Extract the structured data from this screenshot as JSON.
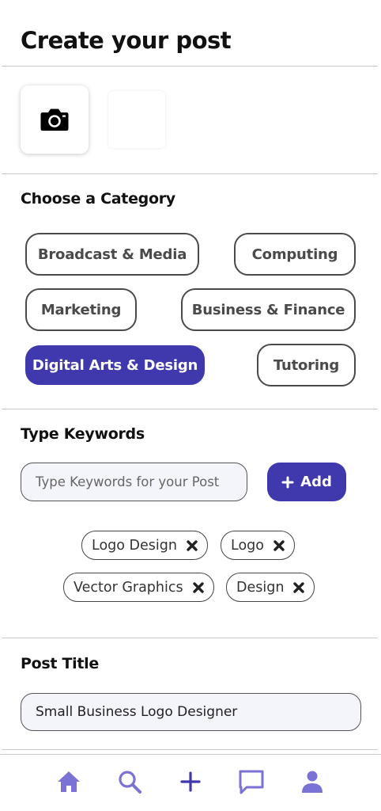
{
  "page": {
    "title": "Create your post"
  },
  "photos": {
    "camera_icon": "camera-icon"
  },
  "category": {
    "label": "Choose a Category",
    "options": [
      {
        "label": "Broadcast & Media",
        "selected": false
      },
      {
        "label": "Computing",
        "selected": false
      },
      {
        "label": "Marketing",
        "selected": false
      },
      {
        "label": "Business & Finance",
        "selected": false
      },
      {
        "label": "Digital Arts & Design",
        "selected": true
      },
      {
        "label": "Tutoring",
        "selected": false
      }
    ]
  },
  "keywords": {
    "label": "Type Keywords",
    "input_placeholder": "Type Keywords for your Post",
    "add_label": "Add",
    "tags": [
      "Logo Design",
      "Logo",
      "Vector Graphics",
      "Design"
    ]
  },
  "post_title": {
    "label": "Post Title",
    "value": "Small Business Logo Designer"
  },
  "nav": {
    "items": [
      "home-icon",
      "search-icon",
      "plus-icon",
      "chat-icon",
      "profile-icon"
    ]
  },
  "colors": {
    "accent": "#4038ad",
    "nav_icon": "#7a72d4",
    "outline": "#4a4a4a"
  }
}
